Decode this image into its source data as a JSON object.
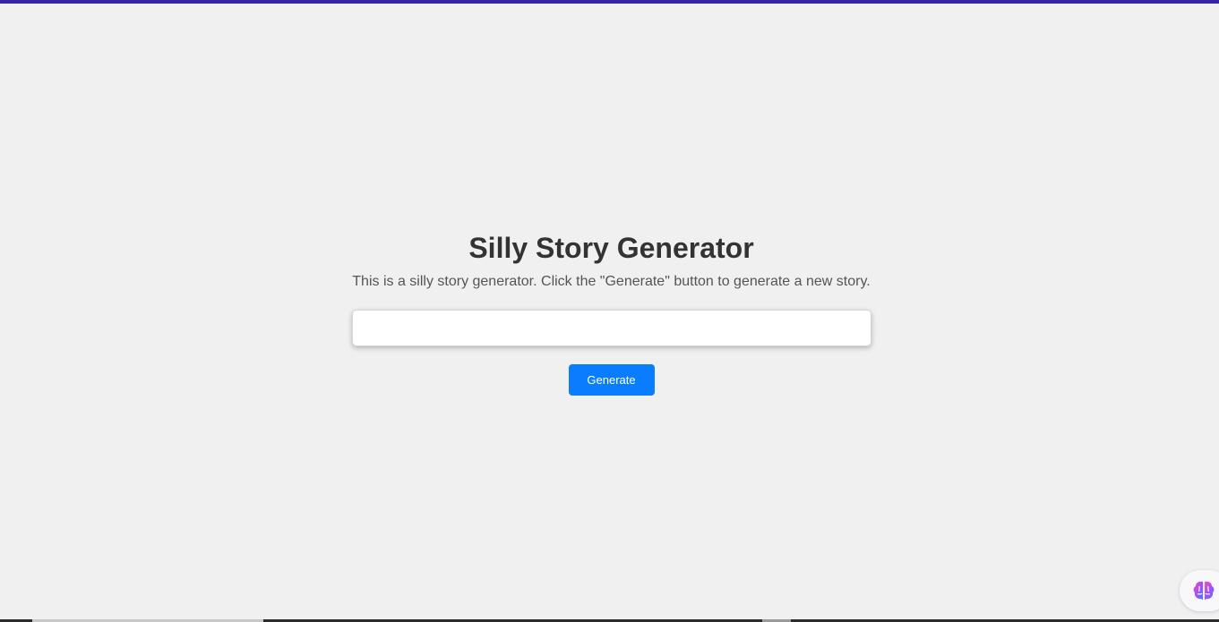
{
  "page": {
    "title": "Silly Story Generator",
    "description": "This is a silly story generator. Click the \"Generate\" button to generate a new story.",
    "story_text": "",
    "generate_label": "Generate"
  },
  "floating_button": {
    "icon": "brain-icon"
  },
  "colors": {
    "top_bar": "#3524a8",
    "button": "#0a7dff",
    "background": "#f0f0f1"
  }
}
